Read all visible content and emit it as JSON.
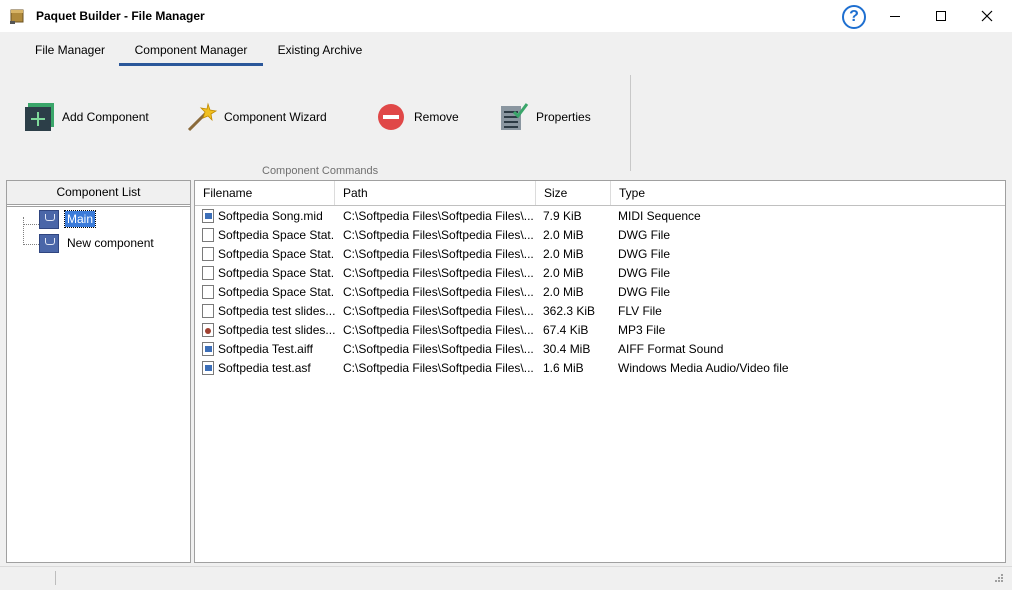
{
  "window": {
    "title": "Paquet Builder - File Manager",
    "help_label": "?"
  },
  "ribbon": {
    "tabs": [
      {
        "label": "File Manager",
        "active": false
      },
      {
        "label": "Component Manager",
        "active": true
      },
      {
        "label": "Existing Archive",
        "active": false
      }
    ],
    "commands": {
      "add": "Add Component",
      "wizard": "Component Wizard",
      "remove": "Remove",
      "properties": "Properties"
    },
    "group_label": "Component Commands",
    "accent_color": "#2b579a"
  },
  "component_list": {
    "header": "Component List",
    "items": [
      {
        "label": "Main",
        "selected": true
      },
      {
        "label": "New component",
        "selected": false
      }
    ]
  },
  "file_list": {
    "columns": [
      "Filename",
      "Path",
      "Size",
      "Type"
    ],
    "rows": [
      {
        "icon": "media-file-icon",
        "name": "Softpedia Song.mid",
        "path": "C:\\Softpedia Files\\Softpedia Files\\...",
        "size": "7.9 KiB",
        "type": "MIDI Sequence"
      },
      {
        "icon": "blank-file-icon",
        "name": "Softpedia Space Stat...",
        "path": "C:\\Softpedia Files\\Softpedia Files\\...",
        "size": "2.0 MiB",
        "type": "DWG File"
      },
      {
        "icon": "blank-file-icon",
        "name": "Softpedia Space Stat...",
        "path": "C:\\Softpedia Files\\Softpedia Files\\...",
        "size": "2.0 MiB",
        "type": "DWG File"
      },
      {
        "icon": "blank-file-icon",
        "name": "Softpedia Space Stat...",
        "path": "C:\\Softpedia Files\\Softpedia Files\\...",
        "size": "2.0 MiB",
        "type": "DWG File"
      },
      {
        "icon": "blank-file-icon",
        "name": "Softpedia Space Stat...",
        "path": "C:\\Softpedia Files\\Softpedia Files\\...",
        "size": "2.0 MiB",
        "type": "DWG File"
      },
      {
        "icon": "blank-file-icon",
        "name": "Softpedia test slides...",
        "path": "C:\\Softpedia Files\\Softpedia Files\\...",
        "size": "362.3 KiB",
        "type": "FLV File"
      },
      {
        "icon": "audio-file-icon",
        "name": "Softpedia test slides...",
        "path": "C:\\Softpedia Files\\Softpedia Files\\...",
        "size": "67.4 KiB",
        "type": "MP3 File"
      },
      {
        "icon": "media-file-icon",
        "name": "Softpedia Test.aiff",
        "path": "C:\\Softpedia Files\\Softpedia Files\\...",
        "size": "30.4 MiB",
        "type": "AIFF Format Sound"
      },
      {
        "icon": "media-file-icon",
        "name": "Softpedia test.asf",
        "path": "C:\\Softpedia Files\\Softpedia Files\\...",
        "size": "1.6 MiB",
        "type": "Windows Media Audio/Video file"
      }
    ]
  }
}
